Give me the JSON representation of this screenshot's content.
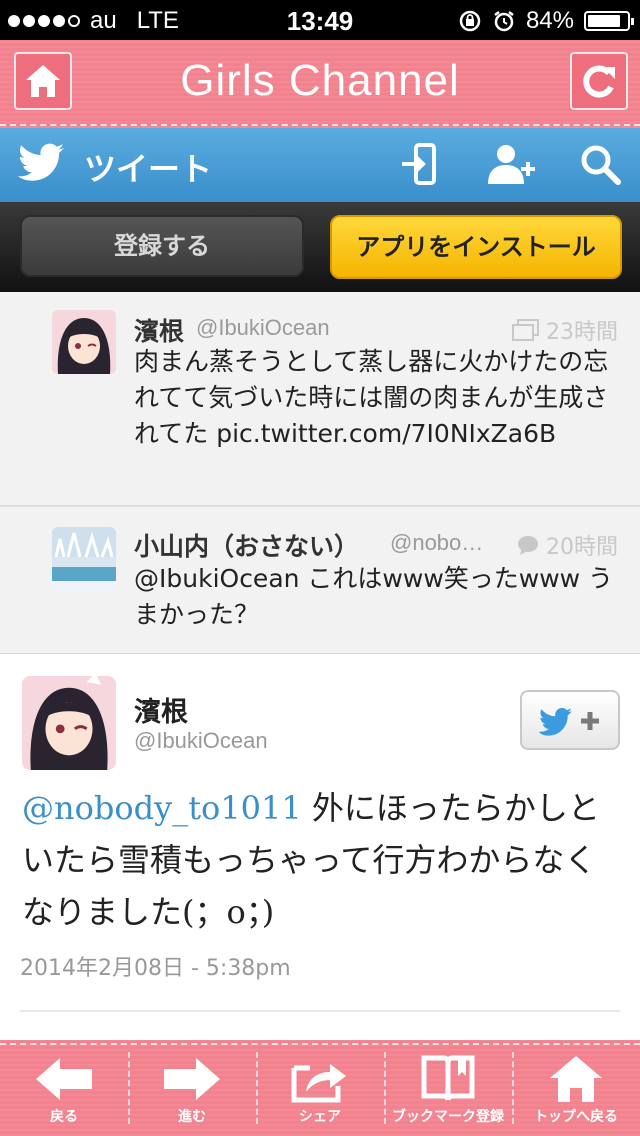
{
  "status_bar": {
    "carrier": "au",
    "network": "LTE",
    "time": "13:49",
    "battery": "84%",
    "battery_level": 0.84,
    "signal_bars": 4
  },
  "header": {
    "title": "Girls Channel",
    "home_icon": "home-icon",
    "refresh_icon": "refresh-icon"
  },
  "tweet_bar": {
    "label": "ツイート",
    "icons": [
      "twitter-bird-icon",
      "sign-in-icon",
      "add-user-icon",
      "search-icon"
    ]
  },
  "install_bar": {
    "register_label": "登録する",
    "install_label": "アプリをインストール",
    "install_color": "#f8c21a"
  },
  "conversation": [
    {
      "name": "濱根",
      "handle": "@IbukiOcean",
      "time": "23時間",
      "text": "肉まん蒸そうとして蒸し器に火かけたの忘れてて気づいた時には闇の肉まんが生成されてた pic.twitter.com/7I0NIxZa6B",
      "meta_icon": "image-icon"
    },
    {
      "name": "小山内（おさない）",
      "handle": "@nobo…",
      "time": "20時間",
      "text": "@IbukiOcean これはwww笑ったwww うまかった？",
      "meta_icon": "reply-bubble-icon"
    }
  ],
  "main_tweet": {
    "name": "濱根",
    "handle": "@IbukiOcean",
    "mention": "@nobody_to1011",
    "text": "外にほったらかしといたら雪積もっちゃって行方わからなくなりました(；o；)",
    "date": "2014年2月08日 - 5:38pm",
    "follow_icon": "twitter-follow-icon",
    "mention_color": "#3a8fcb"
  },
  "toolbar": {
    "items": [
      {
        "label": "戻る",
        "icon": "back-arrow-icon"
      },
      {
        "label": "進む",
        "icon": "forward-arrow-icon"
      },
      {
        "label": "シェア",
        "icon": "share-icon"
      },
      {
        "label": "ブックマーク登録",
        "icon": "bookmark-book-icon"
      },
      {
        "label": "トップへ戻る",
        "icon": "home-icon"
      }
    ]
  },
  "colors": {
    "pink": "#f3828f",
    "twitter_blue": "#3a8fcb",
    "dark_bar": "#1a1a1a"
  }
}
